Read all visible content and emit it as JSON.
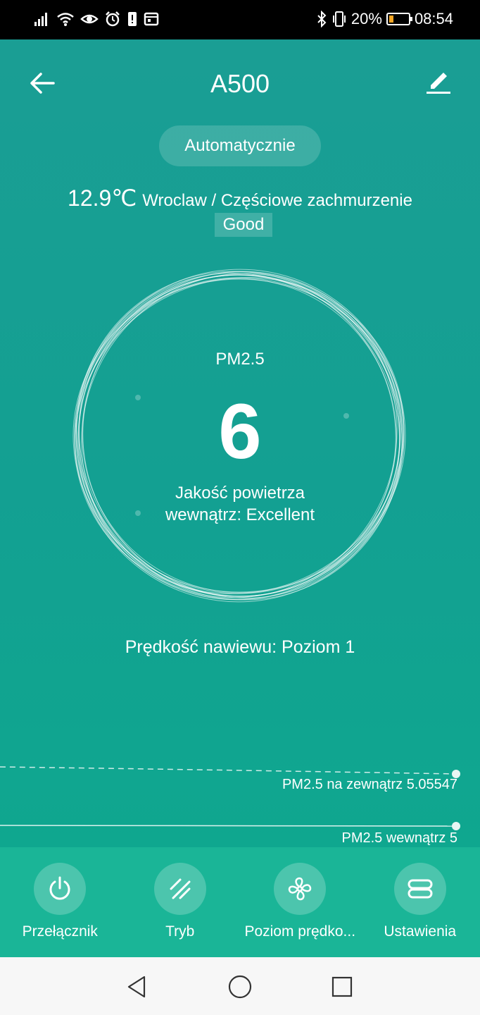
{
  "status_bar": {
    "battery_percent": "20%",
    "battery_level": 0.2,
    "time": "08:54",
    "icons": [
      "signal-icon",
      "wifi-icon",
      "eye-icon",
      "alarm-icon",
      "alert-icon",
      "calendar-icon",
      "bluetooth-icon",
      "vibrate-icon",
      "battery-icon"
    ]
  },
  "header": {
    "title": "A500",
    "back_icon": "arrow-left-icon",
    "edit_icon": "pencil-icon"
  },
  "mode": "Automatycznie",
  "weather": {
    "temperature": "12.9℃",
    "location_condition": "Wroclaw / Częściowe zachmurzenie",
    "outdoor_quality": "Good"
  },
  "reading": {
    "label": "PM2.5",
    "value": "6",
    "quality_line1": "Jakość powietrza",
    "quality_line2": "wewnątrz: Excellent"
  },
  "fan_speed": "Prędkość nawiewu: Poziom 1",
  "trend": {
    "outdoor_label": "PM2.5 na zewnątrz 5.05547",
    "indoor_label": "PM2.5 wewnątrz 5"
  },
  "actions": [
    {
      "label": "Przełącznik",
      "icon": "power-icon"
    },
    {
      "label": "Tryb",
      "icon": "mode-icon"
    },
    {
      "label": "Poziom prędko...",
      "icon": "fan-icon"
    },
    {
      "label": "Ustawienia",
      "icon": "settings-icon"
    }
  ],
  "colors": {
    "background": "#13a092",
    "actions_bar": "#1ab597",
    "battery_fill": "#f5a623"
  }
}
